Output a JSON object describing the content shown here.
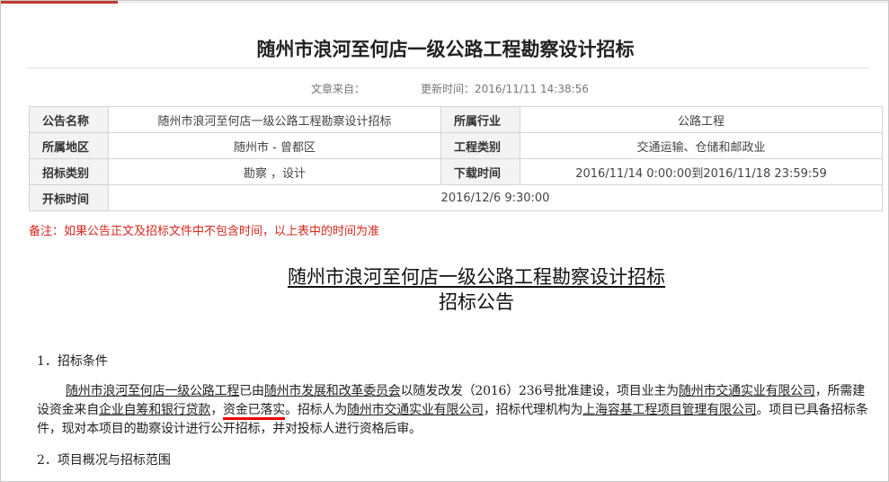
{
  "page_title": "随州市浪河至何店一级公路工程勘察设计招标",
  "meta": {
    "source_label": "文章来自：",
    "source_value": "",
    "update_label": "更新时间：",
    "update_value": "2016/11/11 14:38:56"
  },
  "info_table": {
    "r1": {
      "l1": "公告名称",
      "v1": "随州市浪河至何店一级公路工程勘察设计招标",
      "l2": "所属行业",
      "v2": "公路工程"
    },
    "r2": {
      "l1": "所属地区",
      "v1": "随州市 - 曾都区",
      "l2": "工程类别",
      "v2": "交通运输、仓储和邮政业"
    },
    "r3": {
      "l1": "招标类别",
      "v1": "勘察 ，设计",
      "l2": "下载时间",
      "v2": "2016/11/14 0:00:00到2016/11/18 23:59:59"
    },
    "r4": {
      "l1": "开标时间",
      "v1": "2016/12/6 9:30:00"
    }
  },
  "note": "备注：如果公告正文及招标文件中不包含时间，以上表中的时间为准",
  "doc": {
    "title_line1": "随州市浪河至何店一级公路工程勘察设计招标",
    "title_line2": "招标公告",
    "section1": "1．招标条件",
    "p": {
      "s1": "随州市浪河至何店一级公路工程",
      "s2": "已由",
      "s3": "随州市发展和改革委员会",
      "s4": "以随发改发（2016）236号批准建设，项目业主为",
      "s5": "随州市交通实业有限公司",
      "s6": "，所需建设资金来自",
      "s7": "企业自筹和银行贷款",
      "s8": "，",
      "s9": "资金已落实",
      "s10": "。招标人为",
      "s11": "随州市交通实业有限公司",
      "s12": "，招标代理机构为",
      "s13": "上海容基工程项目管理有限公司",
      "s14": "。项目已具备招标条件，现对本项目的勘察设计进行公开招标，并对投标人进行资格后审。"
    },
    "section2": "2．项目概况与招标范围"
  },
  "colors": {
    "accent": "#c0392b",
    "note": "#d9261c",
    "highlight_underline": "#e00000"
  }
}
